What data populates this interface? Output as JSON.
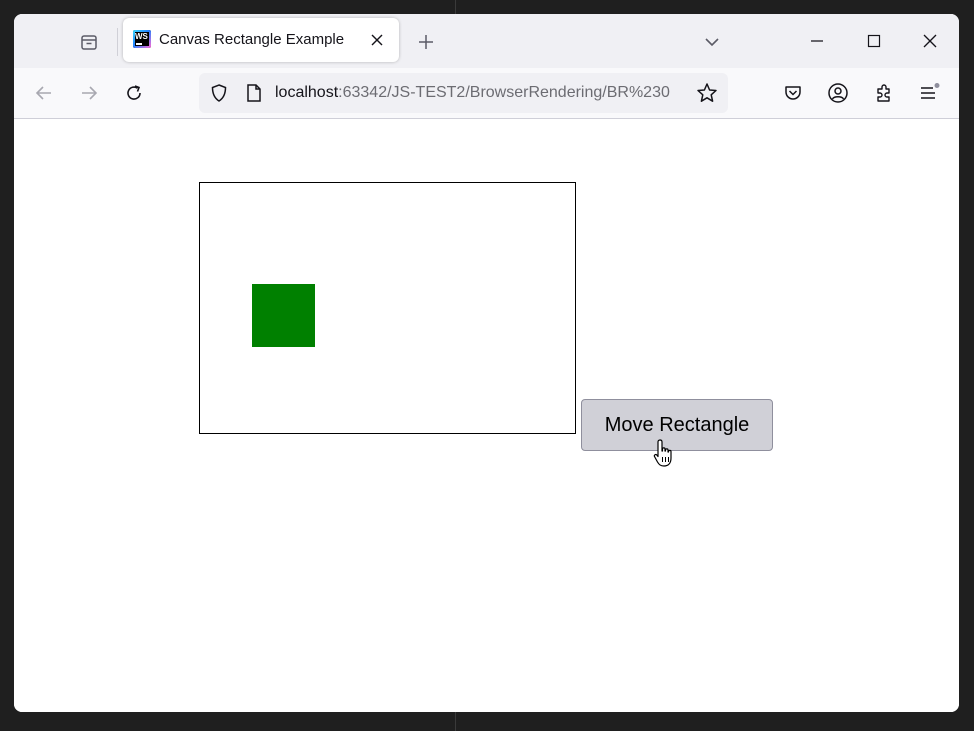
{
  "browser": {
    "tab": {
      "title": "Canvas Rectangle Example",
      "favicon_text": "WS",
      "favicon": "webstorm-icon"
    },
    "icons": {
      "tab_list": "firefox-view-icon",
      "close_tab": "close-icon",
      "new_tab": "plus-icon",
      "list_all_tabs": "chevron-down-icon",
      "minimize": "minimize-icon",
      "maximize": "maximize-icon",
      "close_window": "close-icon",
      "back": "back-arrow-icon",
      "forward": "forward-arrow-icon",
      "reload": "reload-icon",
      "tracking": "shield-icon",
      "page_info": "page-icon",
      "bookmark": "star-icon",
      "pocket": "pocket-icon",
      "account": "account-icon",
      "extensions": "puzzle-icon",
      "menu": "hamburger-menu-icon"
    },
    "url": {
      "host": "localhost",
      "path": ":63342/JS-TEST2/BrowserRendering/BR%230"
    }
  },
  "page": {
    "canvas": {
      "rectangle_color": "#008000"
    },
    "button": {
      "label": "Move Rectangle"
    }
  },
  "colors": {
    "tabbar_bg": "#f0f0f4",
    "navbar_bg": "#f9f9fb",
    "button_bg": "#d0d0d7"
  }
}
